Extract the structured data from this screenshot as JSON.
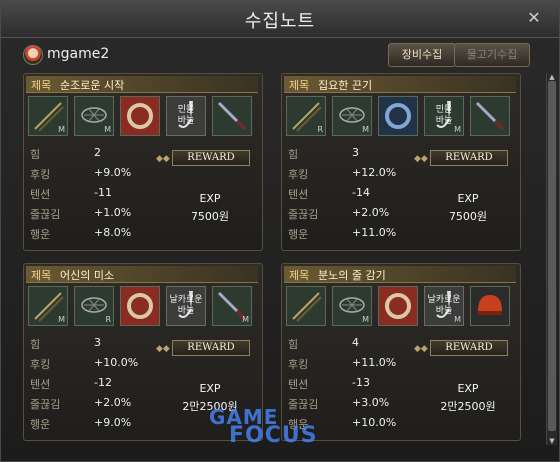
{
  "window": {
    "title": "수집노트",
    "close_glyph": "✕"
  },
  "user": {
    "name": "mgame2"
  },
  "buttons": {
    "equip": "장비수집",
    "fish": "물고기수집"
  },
  "panels": [
    {
      "title_label": "제목",
      "title": "순조로운 시작",
      "slots": [
        {
          "icon": "fishing-rod-icon",
          "tag": "M",
          "text": "",
          "style": "green"
        },
        {
          "icon": "net-icon",
          "tag": "M",
          "text": "",
          "style": "green"
        },
        {
          "icon": "ring-icon",
          "tag": "",
          "text": "",
          "style": "ring-red"
        },
        {
          "icon": "needle-icon",
          "tag": "",
          "text": "민물\n바늘",
          "style": "grey"
        },
        {
          "icon": "knife-icon",
          "tag": "",
          "text": "",
          "style": "dark"
        }
      ],
      "stats": [
        {
          "label": "힘",
          "value": "2"
        },
        {
          "label": "후킹",
          "value": "+9.0%"
        },
        {
          "label": "텐션",
          "value": "-11"
        },
        {
          "label": "줄끊김",
          "value": "+1.0%"
        },
        {
          "label": "행운",
          "value": "+8.0%"
        }
      ],
      "reward_label": "REWARD",
      "exp": "EXP",
      "money": "7500원"
    },
    {
      "title_label": "제목",
      "title": "집요한 끈기",
      "slots": [
        {
          "icon": "fishing-rod-icon",
          "tag": "R",
          "text": "",
          "style": "green"
        },
        {
          "icon": "net-icon",
          "tag": "M",
          "text": "",
          "style": "green"
        },
        {
          "icon": "ring-icon",
          "tag": "",
          "text": "",
          "style": "ring-blue"
        },
        {
          "icon": "needle-icon",
          "tag": "M",
          "text": "민물\n바늘",
          "style": "green"
        },
        {
          "icon": "knife-icon",
          "tag": "",
          "text": "",
          "style": "green"
        }
      ],
      "stats": [
        {
          "label": "힘",
          "value": "3"
        },
        {
          "label": "후킹",
          "value": "+12.0%"
        },
        {
          "label": "텐션",
          "value": "-14"
        },
        {
          "label": "줄끊김",
          "value": "+2.0%"
        },
        {
          "label": "행운",
          "value": "+11.0%"
        }
      ],
      "reward_label": "REWARD",
      "exp": "EXP",
      "money": "7500원"
    },
    {
      "title_label": "제목",
      "title": "어신의 미소",
      "slots": [
        {
          "icon": "fishing-rod-icon",
          "tag": "M",
          "text": "",
          "style": "green"
        },
        {
          "icon": "net-icon",
          "tag": "R",
          "text": "",
          "style": "green"
        },
        {
          "icon": "ring-icon",
          "tag": "",
          "text": "",
          "style": "ring-red"
        },
        {
          "icon": "needle-icon",
          "tag": "",
          "text": "날카로운\n바늘",
          "style": "grey"
        },
        {
          "icon": "knife-icon",
          "tag": "M",
          "text": "",
          "style": "green"
        }
      ],
      "stats": [
        {
          "label": "힘",
          "value": "3"
        },
        {
          "label": "후킹",
          "value": "+10.0%"
        },
        {
          "label": "텐션",
          "value": "-12"
        },
        {
          "label": "줄끊김",
          "value": "+2.0%"
        },
        {
          "label": "행운",
          "value": "+9.0%"
        }
      ],
      "reward_label": "REWARD",
      "exp": "EXP",
      "money": "2만2500원"
    },
    {
      "title_label": "제목",
      "title": "분노의 줄 감기",
      "slots": [
        {
          "icon": "fishing-rod-icon",
          "tag": "",
          "text": "",
          "style": "green"
        },
        {
          "icon": "net-icon",
          "tag": "M",
          "text": "",
          "style": "green"
        },
        {
          "icon": "ring-icon",
          "tag": "",
          "text": "",
          "style": "ring-red"
        },
        {
          "icon": "needle-icon",
          "tag": "M",
          "text": "날카로운\n바늘",
          "style": "grey"
        },
        {
          "icon": "helmet-icon",
          "tag": "",
          "text": "",
          "style": "helmet"
        }
      ],
      "stats": [
        {
          "label": "힘",
          "value": "4"
        },
        {
          "label": "후킹",
          "value": "+11.0%"
        },
        {
          "label": "텐션",
          "value": "-13"
        },
        {
          "label": "줄끊김",
          "value": "+3.0%"
        },
        {
          "label": "행운",
          "value": "+10.0%"
        }
      ],
      "reward_label": "REWARD",
      "exp": "EXP",
      "money": "2만2500원"
    }
  ],
  "watermark": {
    "line1": "GAME",
    "line2": "FOCUS"
  }
}
